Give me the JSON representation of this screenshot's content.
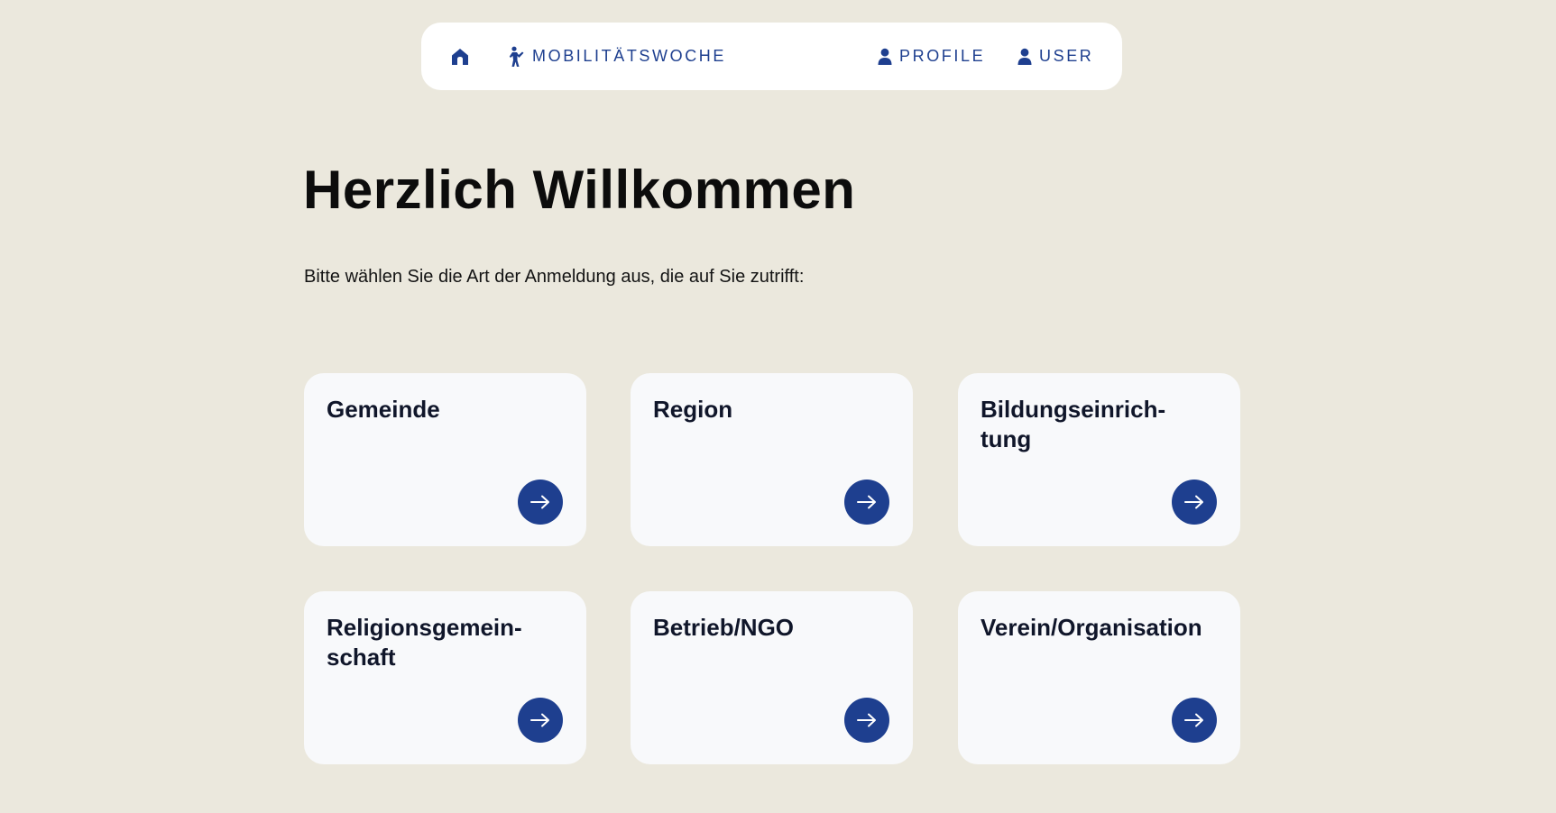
{
  "nav": {
    "home_icon": "home-icon",
    "mobility_icon": "pedestrian-icon",
    "mobility_label": "MOBILITÄTSWOCHE",
    "profile_icon": "person-icon",
    "profile_label": "PROFILE",
    "user_icon": "person-icon",
    "user_label": "USER"
  },
  "main": {
    "title": "Herzlich Willkommen",
    "intro": "Bitte wählen Sie die Art der Anmeldung aus, die auf Sie zutrifft:"
  },
  "cards": [
    {
      "label": "Gemeinde",
      "icon": "arrow-right-icon"
    },
    {
      "label": "Region",
      "icon": "arrow-right-icon"
    },
    {
      "label": "Bildungseinrich-\ntung",
      "icon": "arrow-right-icon"
    },
    {
      "label": "Religionsgemein-\nschaft",
      "icon": "arrow-right-icon"
    },
    {
      "label": "Betrieb/NGO",
      "icon": "arrow-right-icon"
    },
    {
      "label": "Verein/Organisation",
      "icon": "arrow-right-icon"
    }
  ],
  "colors": {
    "accent": "#1e3f8f",
    "background": "#ebe8dd",
    "card": "#f8f9fb",
    "text": "#0c0c0c"
  }
}
